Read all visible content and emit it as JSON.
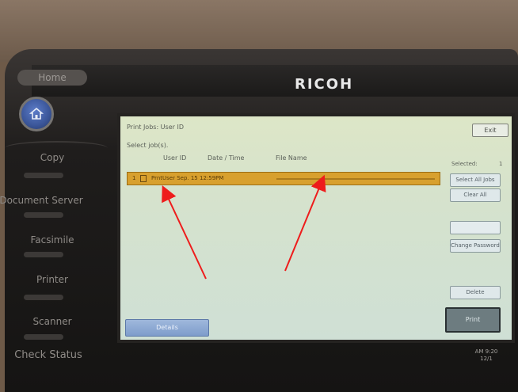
{
  "device": {
    "brand": "RICOH",
    "home_label": "Home"
  },
  "side_keys": [
    "Copy",
    "Document Server",
    "Facsimile",
    "Printer",
    "Scanner",
    "Check Status"
  ],
  "screen": {
    "title": "Print Jobs: User ID",
    "subtitle": "Select job(s).",
    "exit_label": "Exit",
    "columns": [
      "User ID",
      "Date / Time",
      "File Name"
    ],
    "rows": [
      {
        "index": "1",
        "text": "PrntUser  Sep. 15  12:59PM"
      }
    ],
    "selected_label": "Selected:",
    "selected_count": "1",
    "buttons": {
      "select_all": "Select All Jobs",
      "clear_all": "Clear All",
      "change_password": "Change Password",
      "delete": "Delete",
      "print": "Print",
      "details": "Details"
    },
    "status": "AM  9:20\n12/1"
  },
  "annotations": {
    "arrow_color": "#ee1c1c"
  }
}
